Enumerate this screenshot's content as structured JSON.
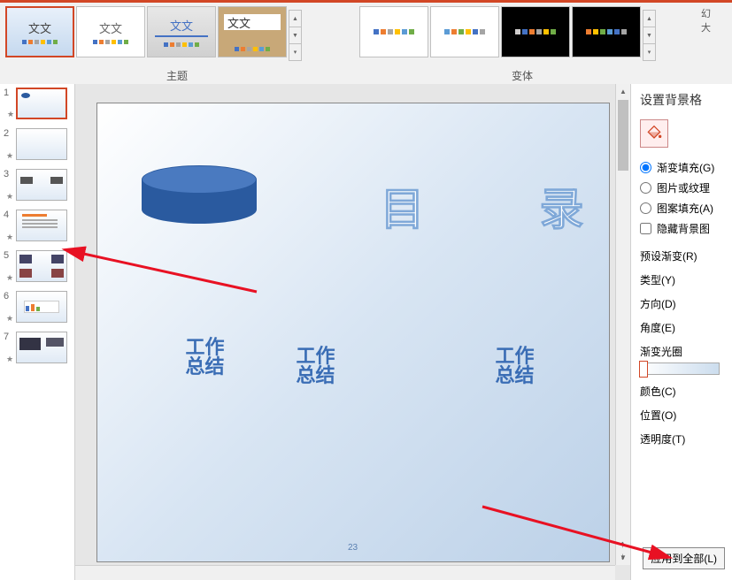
{
  "ribbon": {
    "theme_label": "文文",
    "section_theme": "主题",
    "section_variant": "变体",
    "right_controls": "幻",
    "right_controls2": "大"
  },
  "slides": {
    "numbers": [
      "1",
      "2",
      "3",
      "4",
      "5",
      "6",
      "7"
    ]
  },
  "canvas": {
    "mu_char1": "目",
    "mu_char2": "录",
    "work_line1": "工作",
    "work_line2": "总结",
    "page_number": "23"
  },
  "format_pane": {
    "title": "设置背景格",
    "radio_gradient": "渐变填充(G)",
    "radio_picture": "图片或纹理",
    "radio_pattern": "图案填充(A)",
    "check_hide_bg": "隐藏背景图",
    "preset": "预设渐变(R)",
    "type": "类型(Y)",
    "direction": "方向(D)",
    "angle": "角度(E)",
    "gradient_stops": "渐变光圈",
    "color": "颜色(C)",
    "position": "位置(O)",
    "transparency": "透明度(T)",
    "apply_all": "应用到全部(L)"
  },
  "variant_colors": [
    [
      "#4472c4",
      "#ed7d31",
      "#a5a5a5",
      "#ffc000",
      "#5b9bd5",
      "#70ad47"
    ],
    [
      "#5b9bd5",
      "#ed7d31",
      "#70ad47",
      "#ffc000",
      "#4472c4",
      "#a5a5a5"
    ],
    [
      "#d0cece",
      "#4472c4",
      "#ed7d31",
      "#a5a5a5",
      "#ffc000",
      "#70ad47"
    ],
    [
      "#ed7d31",
      "#ffc000",
      "#70ad47",
      "#5b9bd5",
      "#4472c4",
      "#a5a5a5"
    ]
  ]
}
